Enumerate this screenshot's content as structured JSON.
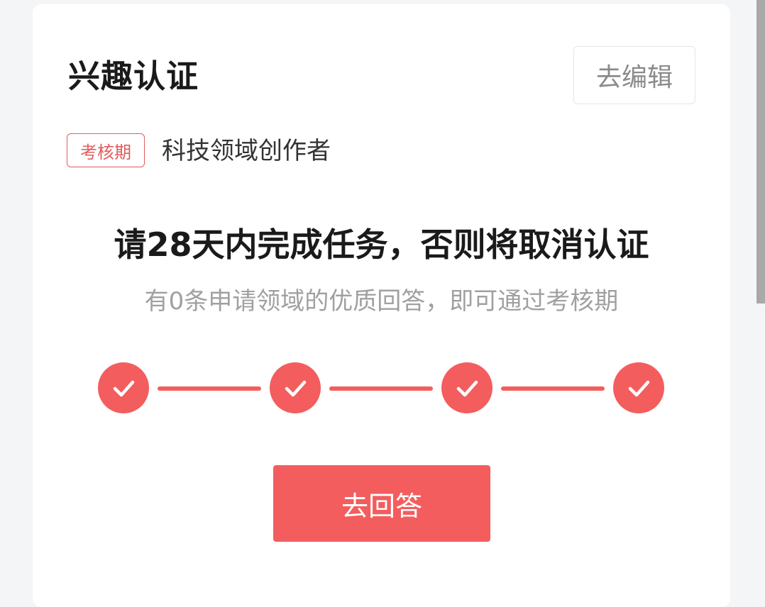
{
  "card": {
    "title": "兴趣认证",
    "edit_label": "去编辑",
    "status_badge": "考核期",
    "domain": "科技领域创作者",
    "headline": "请28天内完成任务，否则将取消认证",
    "subline": "有0条申请领域的优质回答，即可通过考核期",
    "steps": [
      {
        "completed": true,
        "icon": "check-icon"
      },
      {
        "completed": true,
        "icon": "check-icon"
      },
      {
        "completed": true,
        "icon": "check-icon"
      },
      {
        "completed": true,
        "icon": "check-icon"
      }
    ],
    "answer_label": "去回答"
  },
  "colors": {
    "accent": "#f45d5d",
    "badge": "#e25c5c",
    "title": "#1a1a1a",
    "muted": "#a0a0a0"
  }
}
